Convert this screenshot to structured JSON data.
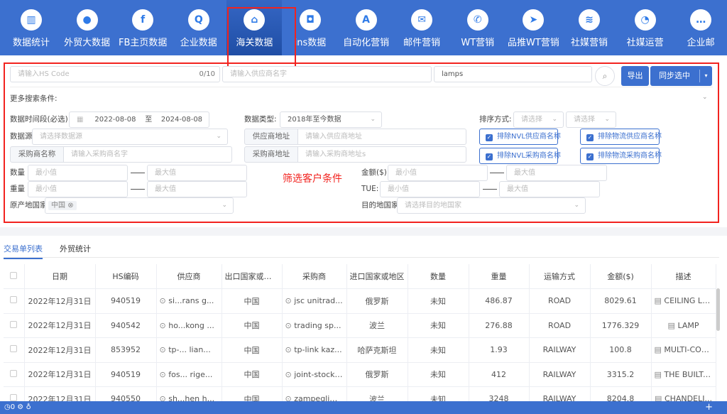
{
  "nav": {
    "items": [
      {
        "label": "数据统计",
        "icon": "bar-chart-icon"
      },
      {
        "label": "外贸大数据",
        "icon": "globe-icon"
      },
      {
        "label": "FB主页数据",
        "icon": "facebook-icon"
      },
      {
        "label": "企业数据",
        "icon": "search-chart-icon"
      },
      {
        "label": "海关数据",
        "icon": "bank-icon"
      },
      {
        "label": "ins数据",
        "icon": "instagram-icon"
      },
      {
        "label": "自动化营销",
        "icon": "automation-icon"
      },
      {
        "label": "邮件营销",
        "icon": "mail-icon"
      },
      {
        "label": "WT营销",
        "icon": "whatsapp-icon"
      },
      {
        "label": "品推WT营销",
        "icon": "send-icon"
      },
      {
        "label": "社媒营销",
        "icon": "layers-icon"
      },
      {
        "label": "社媒运营",
        "icon": "social-icon"
      },
      {
        "label": "企业邮",
        "icon": "chat-icon"
      }
    ],
    "active": 4
  },
  "search": {
    "hs_placeholder": "请输入HS Code",
    "hs_count": "0/10",
    "supplier_placeholder": "请输入供应商名字",
    "keyword": "lamps",
    "export": "导出",
    "sync": "同步选中"
  },
  "filters": {
    "more": "更多搜索条件:",
    "period_label": "数据时间段(必选):",
    "date_from": "2022-08-08",
    "date_to_sep": "至",
    "date_to": "2024-08-08",
    "type_label": "数据类型:",
    "type_value": "2018年至今数据",
    "sort_label": "排序方式:",
    "sort_placeholder": "请选择",
    "source_label": "数据源",
    "source_placeholder": "请选择数据源",
    "supplier_addr_label": "供应商地址",
    "supplier_addr_placeholder": "请输入供应商地址",
    "buyer_name_label": "采购商名称",
    "buyer_name_placeholder": "请输入采购商名字",
    "buyer_addr_label": "采购商地址",
    "buyer_addr_placeholder": "请输入采购商地址s",
    "checkboxes": [
      "排除NVL供应商名称",
      "排除物流供应商名称",
      "排除NVL采购商名称",
      "排除物流采购商名称"
    ],
    "qty_label": "数量",
    "weight_label": "重量",
    "amount_label": "金额($)",
    "tue_label": "TUE:",
    "min": "最小值",
    "max": "最大值",
    "origin_label": "原产地国家",
    "origin_tag": "中国",
    "dest_label": "目的地国家",
    "dest_placeholder": "请选择目的地国家",
    "annotation": "筛选客户条件"
  },
  "tabs": [
    {
      "label": "交易单列表",
      "active": true
    },
    {
      "label": "外贸统计",
      "active": false
    }
  ],
  "table": {
    "headers": [
      "日期",
      "HS编码",
      "供应商",
      "出口国家或地区",
      "采购商",
      "进口国家或地区",
      "数量",
      "重量",
      "运输方式",
      "金额($)",
      "描述"
    ],
    "rows": [
      [
        "2022年12月31日",
        "940519",
        "si...rans g...",
        "中国",
        "jsc unitrad...",
        "俄罗斯",
        "未知",
        "486.87",
        "ROAD",
        "8029.61",
        "CEILING LA..."
      ],
      [
        "2022年12月31日",
        "940542",
        "ho...kong ...",
        "中国",
        "trading sp...",
        "波兰",
        "未知",
        "276.88",
        "ROAD",
        "1776.329",
        "LAMP"
      ],
      [
        "2022年12月31日",
        "853952",
        "tp-... lian...",
        "中国",
        "tp-link kaz...",
        "哈萨克斯坦",
        "未知",
        "1.93",
        "RAILWAY",
        "100.8",
        "MULTI-COL..."
      ],
      [
        "2022年12月31日",
        "940519",
        "fos... rige...",
        "中国",
        "joint-stock ...",
        "俄罗斯",
        "未知",
        "412",
        "RAILWAY",
        "3315.2",
        "THE BUILT-..."
      ],
      [
        "2022年12月31日",
        "940550",
        "sh...hen h...",
        "中国",
        "zampeglim...",
        "波兰",
        "未知",
        "3248",
        "RAILWAY",
        "8204.8",
        "CHANDELI..."
      ]
    ]
  },
  "status": {
    "count": "0"
  }
}
